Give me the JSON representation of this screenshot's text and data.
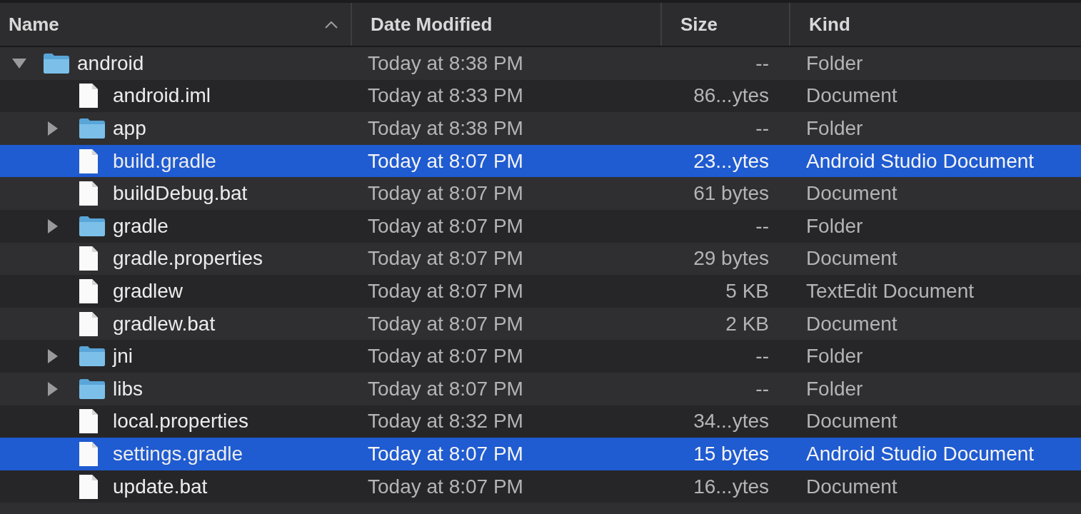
{
  "columns": [
    {
      "label": "Name",
      "sorted": true
    },
    {
      "label": "Date Modified",
      "sorted": false
    },
    {
      "label": "Size",
      "sorted": false
    },
    {
      "label": "Kind",
      "sorted": false
    }
  ],
  "rows": [
    {
      "name": "android",
      "expanded": true,
      "selected": false,
      "date_modified": "Today at 8:38 PM",
      "size": "--",
      "kind": "Folder",
      "children": [
        {
          "name": "android.iml",
          "selected": false,
          "date_modified": "Today at 8:33 PM",
          "size": "86...ytes",
          "kind": "Document"
        },
        {
          "name": "app",
          "expanded": false,
          "selected": false,
          "date_modified": "Today at 8:38 PM",
          "size": "--",
          "kind": "Folder"
        },
        {
          "name": "build.gradle",
          "selected": true,
          "date_modified": "Today at 8:07 PM",
          "size": "23...ytes",
          "kind": "Android Studio Document"
        },
        {
          "name": "buildDebug.bat",
          "selected": false,
          "date_modified": "Today at 8:07 PM",
          "size": "61 bytes",
          "kind": "Document"
        },
        {
          "name": "gradle",
          "expanded": false,
          "selected": false,
          "date_modified": "Today at 8:07 PM",
          "size": "--",
          "kind": "Folder"
        },
        {
          "name": "gradle.properties",
          "selected": false,
          "date_modified": "Today at 8:07 PM",
          "size": "29 bytes",
          "kind": "Document"
        },
        {
          "name": "gradlew",
          "selected": false,
          "date_modified": "Today at 8:07 PM",
          "size": "5 KB",
          "kind": "TextEdit Document"
        },
        {
          "name": "gradlew.bat",
          "selected": false,
          "date_modified": "Today at 8:07 PM",
          "size": "2 KB",
          "kind": "Document"
        },
        {
          "name": "jni",
          "expanded": false,
          "selected": false,
          "date_modified": "Today at 8:07 PM",
          "size": "--",
          "kind": "Folder"
        },
        {
          "name": "libs",
          "expanded": false,
          "selected": false,
          "date_modified": "Today at 8:07 PM",
          "size": "--",
          "kind": "Folder"
        },
        {
          "name": "local.properties",
          "selected": false,
          "date_modified": "Today at 8:32 PM",
          "size": "34...ytes",
          "kind": "Document"
        },
        {
          "name": "settings.gradle",
          "selected": true,
          "date_modified": "Today at 8:07 PM",
          "size": "15 bytes",
          "kind": "Android Studio Document"
        },
        {
          "name": "update.bat",
          "selected": false,
          "date_modified": "Today at 8:07 PM",
          "size": "16...ytes",
          "kind": "Document"
        }
      ]
    }
  ]
}
